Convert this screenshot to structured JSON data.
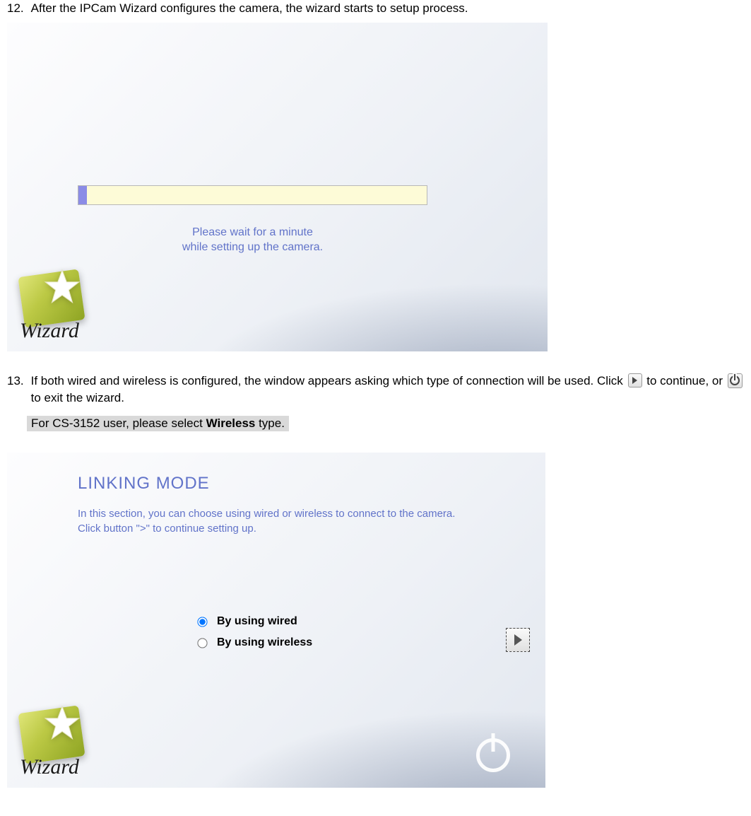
{
  "step12": {
    "num": "12.",
    "text": "After the IPCam Wizard configures the camera, the wizard starts to setup process.",
    "wait_line1": "Please wait for a minute",
    "wait_line2": "while setting up the camera.",
    "wizard_label": "Wizard"
  },
  "step13": {
    "num": "13.",
    "text_part1": "If both wired and wireless is configured, the window appears asking which type of connection will be used. Click ",
    "text_part2": " to continue, or ",
    "text_part3": " to exit the wizard.",
    "note_prefix": "For CS-3152 user, please select ",
    "note_bold": "Wireless",
    "note_suffix": " type.",
    "linking_title": "LINKING MODE",
    "linking_desc": "In this section, you can choose using wired or wireless to connect to the camera. Click button \">\" to continue setting up.",
    "opt_wired": "By using wired",
    "opt_wireless": "By using wireless",
    "wizard_label": "Wizard"
  }
}
